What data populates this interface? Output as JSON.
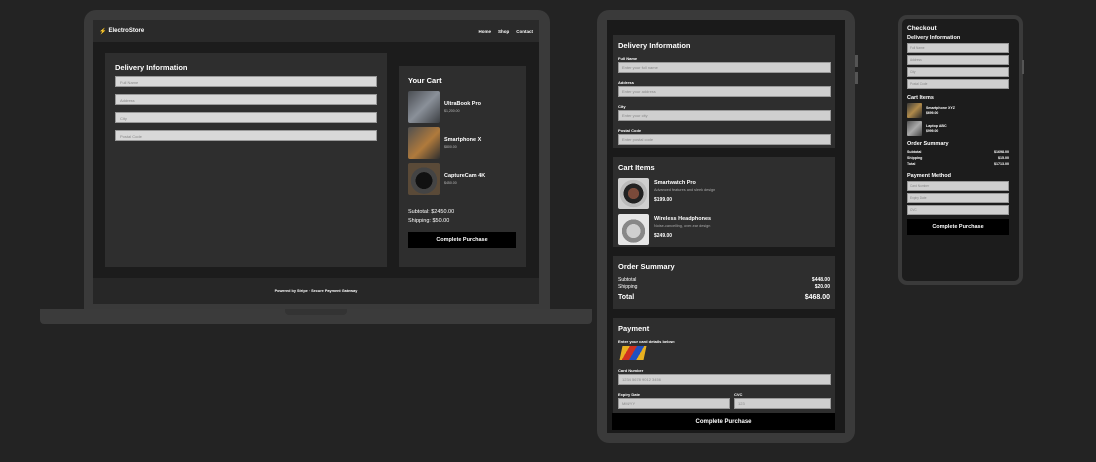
{
  "laptop": {
    "brand": "ElectroStore",
    "nav": [
      "Home",
      "Shop",
      "Contact"
    ],
    "delivery_title": "Delivery Information",
    "placeholders": [
      "Full Name",
      "Address",
      "City",
      "Postal Code"
    ],
    "cart_title": "Your Cart",
    "items": [
      {
        "name": "UltraBook Pro",
        "price": "$1,200.00",
        "image": "laptop"
      },
      {
        "name": "Smartphone X",
        "price": "$800.00",
        "image": "phone"
      },
      {
        "name": "CaptureCam 4K",
        "price": "$450.00",
        "image": "camera"
      }
    ],
    "subtotal": "Subtotal: $2450.00",
    "shipping": "Shipping: $50.00",
    "complete": "Complete Purchase",
    "footer": "Powered by Stripe · Secure Payment Gateway"
  },
  "tablet": {
    "delivery_title": "Delivery Information",
    "fields": [
      {
        "label": "Full Name",
        "placeholder": "Enter your full name"
      },
      {
        "label": "Address",
        "placeholder": "Enter your address"
      },
      {
        "label": "City",
        "placeholder": "Enter your city"
      },
      {
        "label": "Postal Code",
        "placeholder": "Enter postal code"
      }
    ],
    "cart_title": "Cart Items",
    "items": [
      {
        "name": "Smartwatch Pro",
        "desc": "Advanced features and sleek design",
        "price": "$199.00",
        "image": "watch"
      },
      {
        "name": "Wireless Headphones",
        "desc": "Noise-cancelling, over-ear design",
        "price": "$249.00",
        "image": "headphones"
      }
    ],
    "summary_title": "Order Summary",
    "subtotal_label": "Subtotal",
    "subtotal": "$448.00",
    "shipping_label": "Shipping",
    "shipping": "$20.00",
    "total_label": "Total",
    "total": "$468.00",
    "payment_title": "Payment",
    "payment_note": "Enter your card details below:",
    "card_label": "Card Number",
    "card_placeholder": "1234 5678 9012 3456",
    "expiry_label": "Expiry Date",
    "expiry_placeholder": "MM/YY",
    "cvc_label": "CVC",
    "cvc_placeholder": "123",
    "complete": "Complete Purchase"
  },
  "phone": {
    "title": "Checkout",
    "delivery_title": "Delivery Information",
    "placeholders": [
      "Full Name",
      "Address",
      "City",
      "Postal Code"
    ],
    "cart_title": "Cart Items",
    "items": [
      {
        "name": "Smartphone XYZ",
        "price": "$699.00",
        "image": "smartphone"
      },
      {
        "name": "Laptop ABC",
        "price": "$999.00",
        "image": "laptop"
      }
    ],
    "summary_title": "Order Summary",
    "subtotal_label": "Subtotal",
    "subtotal": "$1698.00",
    "shipping_label": "Shipping",
    "shipping": "$15.00",
    "total_label": "Total",
    "total": "$1713.00",
    "payment_title": "Payment Method",
    "payment_placeholders": [
      "Card Number",
      "Expiry Date",
      "CVC"
    ],
    "complete": "Complete Purchase"
  }
}
